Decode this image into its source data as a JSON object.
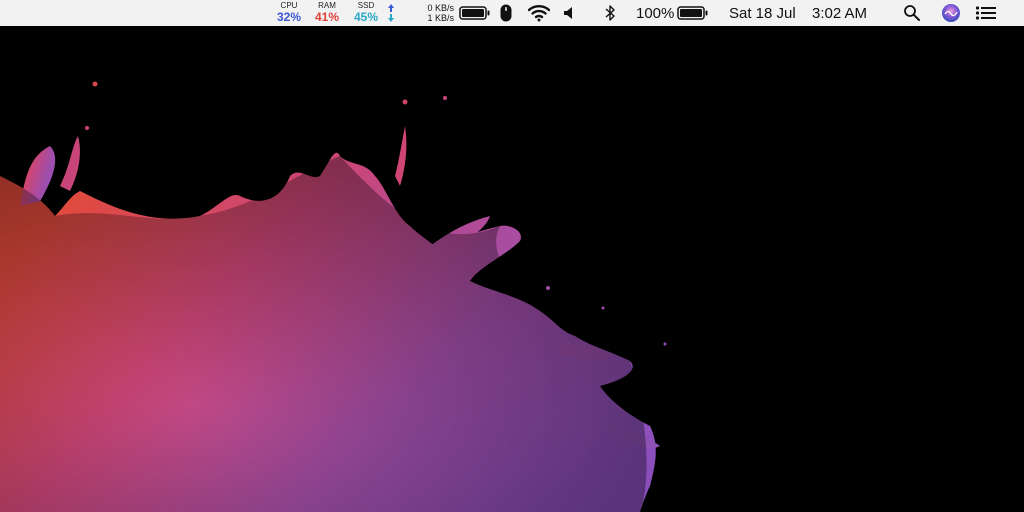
{
  "menubar": {
    "stats": [
      {
        "label": "CPU",
        "value": "32%",
        "color": "#3b57d6"
      },
      {
        "label": "RAM",
        "value": "41%",
        "color": "#e0413a"
      },
      {
        "label": "SSD",
        "value": "45%",
        "color": "#2aa8c9"
      }
    ],
    "net_up": "0 KB/s",
    "net_down": "1 KB/s",
    "battery_percent": "100%",
    "date": "Sat 18 Jul",
    "time": "3:02 AM"
  },
  "icons": {
    "arrows": "up-down-arrows-icon",
    "battery1": "battery-icon",
    "mouse": "mouse-icon",
    "wifi": "wifi-icon",
    "volume": "volume-icon",
    "bluetooth": "bluetooth-icon",
    "search": "search-icon",
    "siri": "siri-icon",
    "notifications": "notification-center-icon"
  },
  "colors": {
    "menubar_bg": "#f2f2f2",
    "desktop_bg": "#000000",
    "splash_red": "#e24a3b",
    "splash_pink": "#c8457a",
    "splash_purple": "#8b4fbd"
  }
}
